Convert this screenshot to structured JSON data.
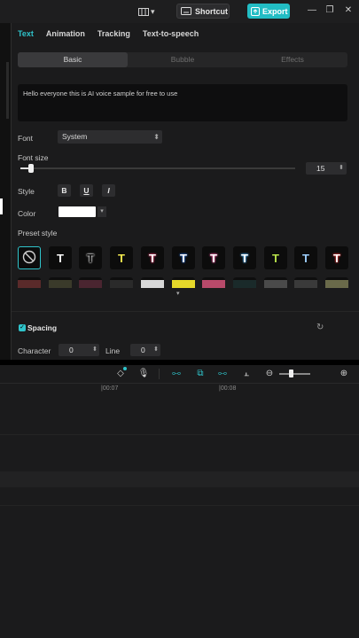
{
  "titlebar": {
    "layout_icon": "layout-icon",
    "shortcut_label": "Shortcut",
    "export_label": "Export",
    "accent": "#22bdc4"
  },
  "panel": {
    "tabs": [
      {
        "label": "Text",
        "active": true
      },
      {
        "label": "Animation",
        "active": false
      },
      {
        "label": "Tracking",
        "active": false
      },
      {
        "label": "Text-to-speech",
        "active": false
      }
    ],
    "segments": [
      {
        "label": "Basic",
        "active": true
      },
      {
        "label": "Bubble",
        "active": false
      },
      {
        "label": "Effects",
        "active": false
      }
    ],
    "text_content": "Hello everyone this is AI voice sample for free to use",
    "font_label": "Font",
    "font_value": "System",
    "font_size_label": "Font size",
    "font_size_value": "15",
    "style_label": "Style",
    "style_buttons": [
      "B",
      "U",
      "I"
    ],
    "color_label": "Color",
    "color_value": "#ffffff",
    "preset_label": "Preset style",
    "presets": [
      {
        "glyph": "⃠",
        "color": "#cfcfcf",
        "outline": "none"
      },
      {
        "glyph": "T",
        "color": "#ffffff",
        "outline": "none"
      },
      {
        "glyph": "T",
        "color": "#111111",
        "outline": "#ffffff"
      },
      {
        "glyph": "T",
        "color": "#f2e94e",
        "outline": "none"
      },
      {
        "glyph": "T",
        "color": "#ffffff",
        "outline": "#e03c6a"
      },
      {
        "glyph": "T",
        "color": "#ffffff",
        "outline": "#2a6fd8"
      },
      {
        "glyph": "T",
        "color": "#ffffff",
        "outline": "#ff5fa8"
      },
      {
        "glyph": "T",
        "color": "#ffffff",
        "outline": "#4fb6ff"
      },
      {
        "glyph": "T",
        "color": "#b9e34a",
        "outline": "none"
      },
      {
        "glyph": "T",
        "color": "#9fd0ff",
        "outline": "none"
      },
      {
        "glyph": "T",
        "color": "#ffffff",
        "outline": "#e83a3a"
      }
    ],
    "presets_row2": [
      "#5a2a2a",
      "#3a3a2a",
      "#4a2530",
      "#2a2a2a",
      "#d8d8d8",
      "#e6d82a",
      "#b84a6a",
      "#1a2a2a",
      "#4a4a4a",
      "#3a3a3a",
      "#6a6a4a"
    ],
    "spacing_label": "Spacing",
    "character_label": "Character",
    "character_value": "0",
    "line_label": "Line",
    "line_value": "0"
  },
  "timeline": {
    "ruler_labels": [
      "|00:07",
      "|00:08"
    ]
  }
}
